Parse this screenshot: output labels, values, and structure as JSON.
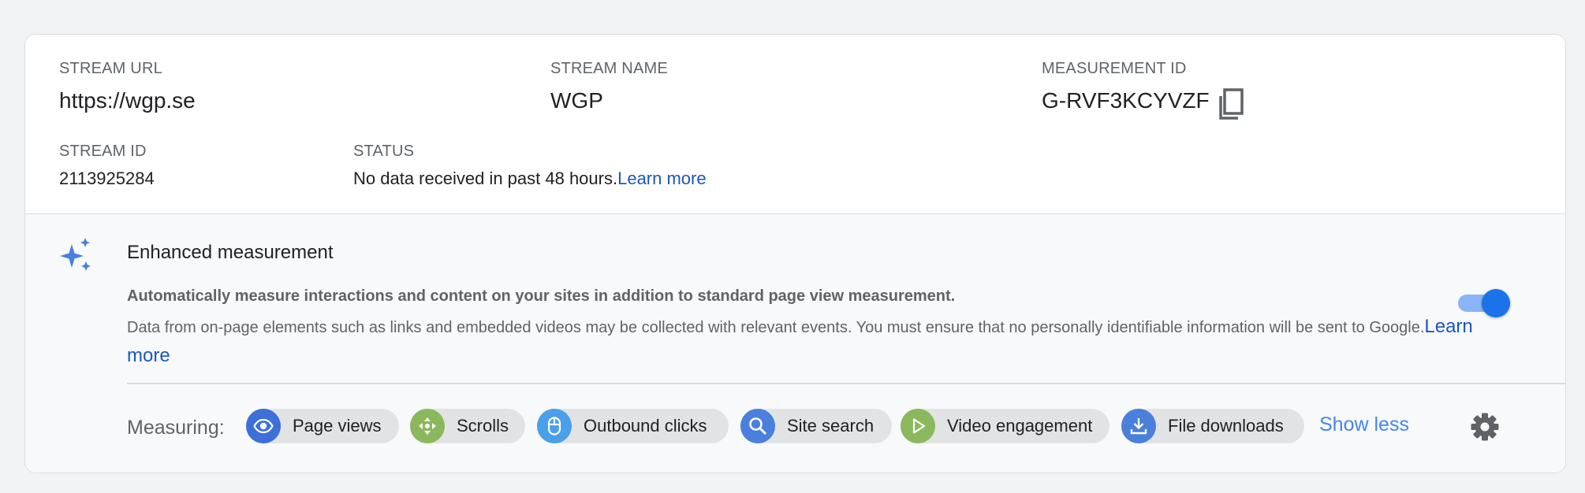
{
  "stream": {
    "url_label": "STREAM URL",
    "url_value": "https://wgp.se",
    "name_label": "STREAM NAME",
    "name_value": "WGP",
    "mid_label": "MEASUREMENT ID",
    "mid_value": "G-RVF3KCYVZF",
    "id_label": "STREAM ID",
    "id_value": "2113925284",
    "status_label": "STATUS",
    "status_value": "No data received in past 48 hours.",
    "status_link": "Learn more"
  },
  "enhanced": {
    "title": "Enhanced measurement",
    "bold_text": "Automatically measure interactions and content on your sites in addition to standard page view measurement.",
    "desc": "Data from on-page elements such as links and embedded videos may be collected with relevant events. You must ensure that no personally identifiable information will be sent to Google.",
    "desc_link": "Learn more",
    "toggle_on": true,
    "measuring_label": "Measuring:",
    "chips": [
      {
        "label": "Page views",
        "icon": "eye-icon",
        "color": "#3c6fd8"
      },
      {
        "label": "Scrolls",
        "icon": "scroll-arrows-icon",
        "color": "#8bb85c"
      },
      {
        "label": "Outbound clicks",
        "icon": "mouse-icon",
        "color": "#4a9fea"
      },
      {
        "label": "Site search",
        "icon": "search-icon",
        "color": "#4a7fdc"
      },
      {
        "label": "Video engagement",
        "icon": "play-icon",
        "color": "#8bb85c"
      },
      {
        "label": "File downloads",
        "icon": "download-icon",
        "color": "#4a7fdc"
      }
    ],
    "show_less": "Show less",
    "settings_icon": "gear-icon"
  },
  "colors": {
    "accent": "#1a73e8",
    "link": "#1a56c4",
    "background": "#f1f3f4"
  }
}
